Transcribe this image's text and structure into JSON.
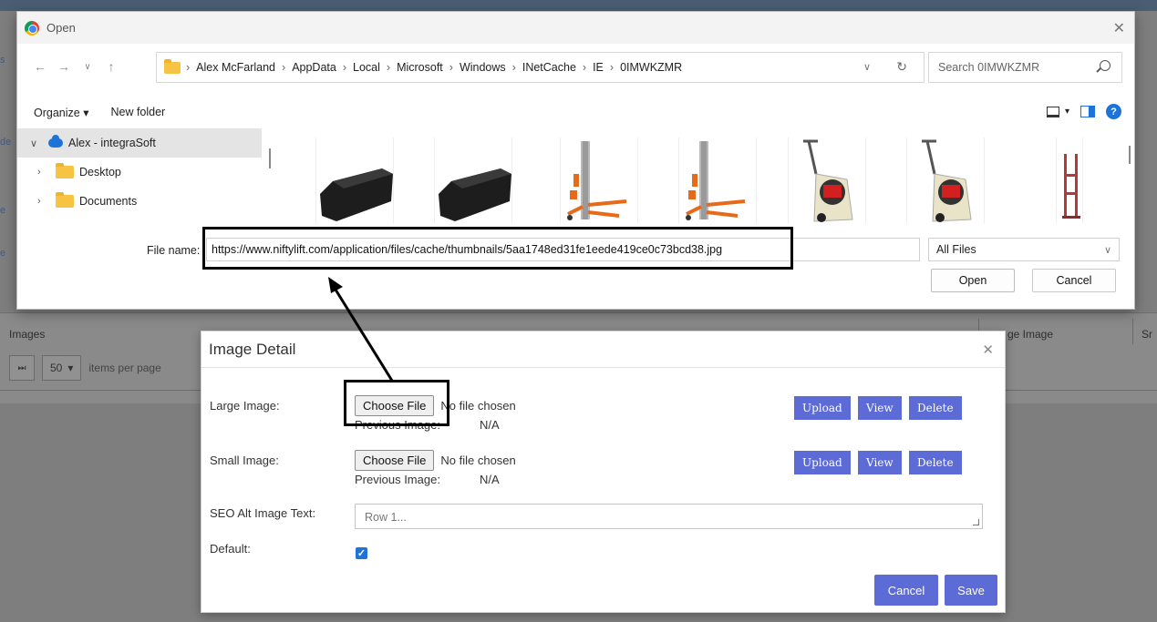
{
  "background": {
    "table_header_images": "Images",
    "table_header_large_image": "ge Image",
    "table_header_right_frag": "Sr",
    "pager_last": "⏭",
    "pager_page_size": "50",
    "pager_items_per_page": "items per page"
  },
  "open_dialog": {
    "title": "Open",
    "breadcrumb": [
      "Alex McFarland",
      "AppData",
      "Local",
      "Microsoft",
      "Windows",
      "INetCache",
      "IE",
      "0IMWKZMR"
    ],
    "search_placeholder": "Search 0IMWKZMR",
    "toolbar": {
      "organize": "Organize ▾",
      "new_folder": "New folder"
    },
    "nav_items": [
      {
        "label": "Alex - integraSoft",
        "icon": "cloud-icon",
        "expanded": true
      },
      {
        "label": "Desktop",
        "icon": "folder-icon"
      },
      {
        "label": "Documents",
        "icon": "folder-icon"
      }
    ],
    "thumbnails": [
      "bucket",
      "bucket",
      "lift",
      "lift",
      "scarifier",
      "scarifier",
      "hand-truck"
    ],
    "file_name_label": "File name:",
    "file_name_value": "https://www.niftylift.com/application/files/cache/thumbnails/5aa1748ed31fe1eede419ce0c73bcd38.jpg",
    "file_type": "All Files",
    "open_label": "Open",
    "cancel_label": "Cancel"
  },
  "modal": {
    "title": "Image Detail",
    "large_image_label": "Large Image:",
    "small_image_label": "Small Image:",
    "choose_file": "Choose File",
    "no_file_chosen": "No file chosen",
    "previous_image_label": "Previous Image:",
    "previous_image_value": "N/A",
    "upload": "Upload",
    "view": "View",
    "delete": "Delete",
    "seo_label": "SEO Alt Image Text:",
    "seo_placeholder": "Row 1...",
    "default_label": "Default:",
    "default_checked": true,
    "cancel": "Cancel",
    "save": "Save"
  },
  "colors": {
    "primary_button": "#5c6bd6",
    "checkbox": "#1e73d8",
    "overlay": "#7e7e7e"
  }
}
